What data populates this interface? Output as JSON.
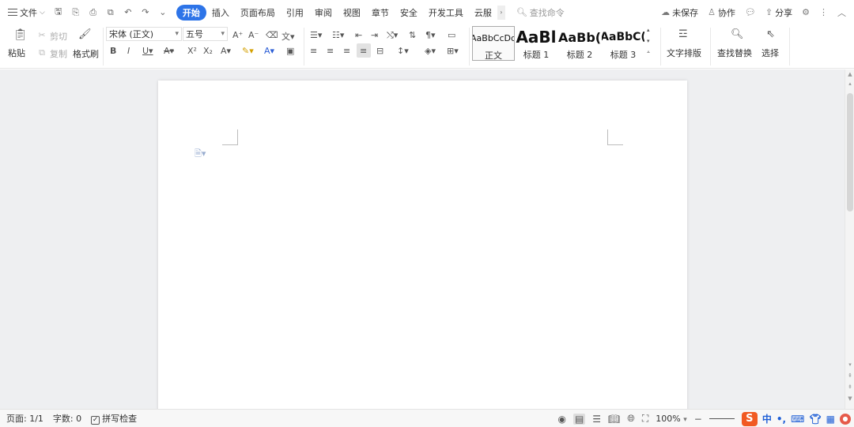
{
  "titlebar": {
    "menu_label": "文件",
    "tabs": [
      {
        "label": "开始",
        "active": true
      },
      {
        "label": "插入"
      },
      {
        "label": "页面布局"
      },
      {
        "label": "引用"
      },
      {
        "label": "审阅"
      },
      {
        "label": "视图"
      },
      {
        "label": "章节"
      },
      {
        "label": "安全"
      },
      {
        "label": "开发工具"
      },
      {
        "label": "云服"
      }
    ],
    "search_placeholder": "查找命令",
    "unsaved_label": "未保存",
    "collab_label": "协作",
    "share_label": "分享"
  },
  "ribbon": {
    "paste_label": "粘贴",
    "cut_label": "剪切",
    "copy_label": "复制",
    "format_painter_label": "格式刷",
    "font_name": "宋体 (正文)",
    "font_size": "五号",
    "styles": [
      {
        "sample": "AaBbCcDd",
        "name": "正文"
      },
      {
        "sample": "AaBl",
        "name": "标题 1"
      },
      {
        "sample": "AaBb(",
        "name": "标题 2"
      },
      {
        "sample": "AaBbC(",
        "name": "标题 3"
      }
    ],
    "text_layout_label": "文字排版",
    "find_replace_label": "查找替换",
    "select_label": "选择"
  },
  "statusbar": {
    "page_info": "页面: 1/1",
    "word_count": "字数: 0",
    "spell_check": "拼写检查",
    "zoom": "100%",
    "ime_lang": "中"
  },
  "colors": {
    "accent": "#2d74e8",
    "workspace_bg": "#eeeff1",
    "ime_orange": "#f15a22"
  }
}
